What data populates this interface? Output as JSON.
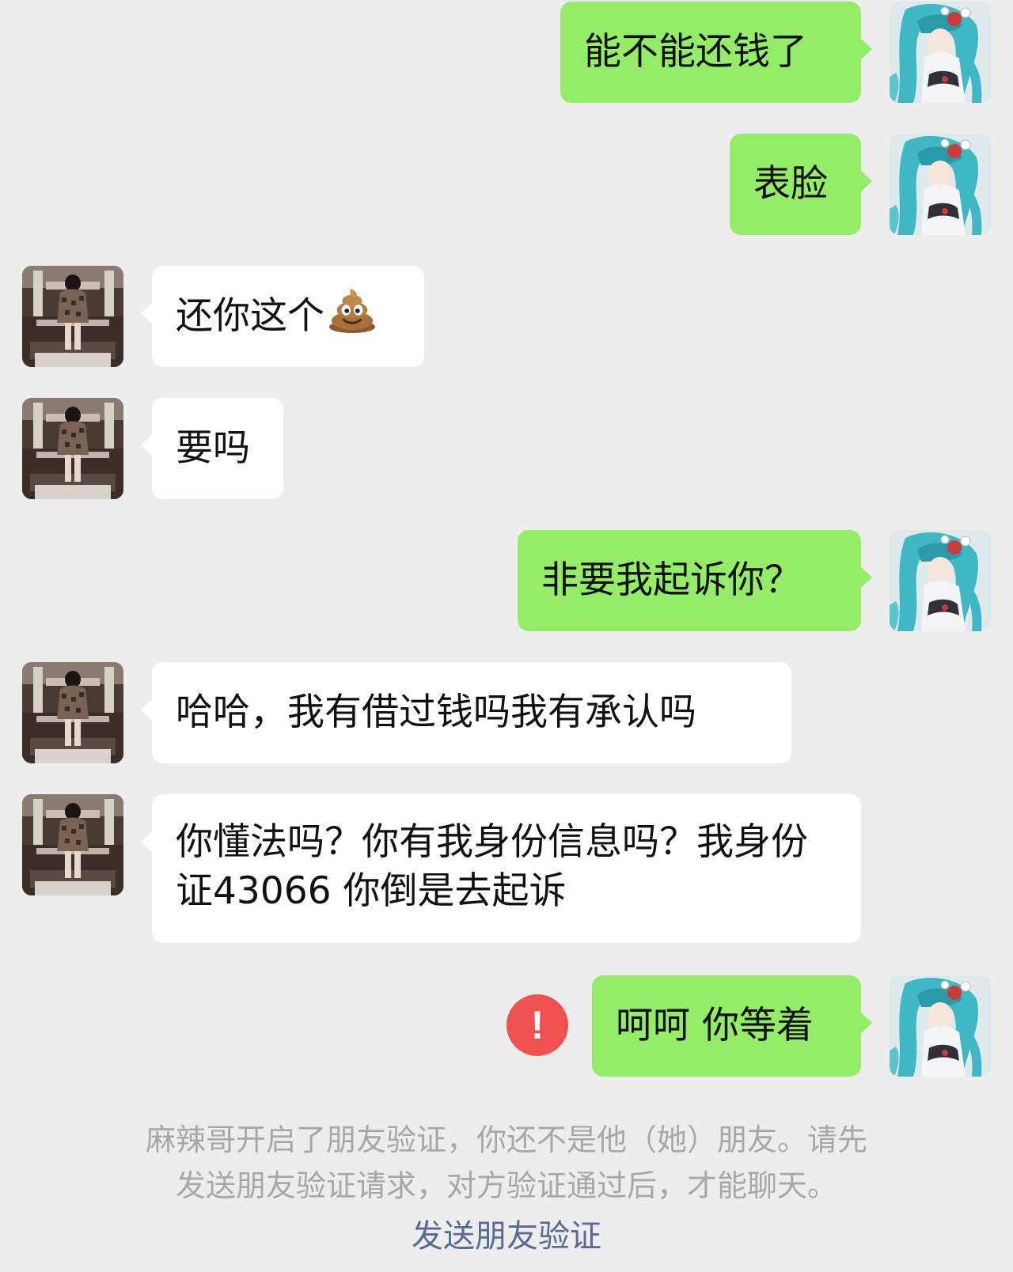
{
  "colors": {
    "background": "#ededed",
    "outgoing_bubble": "#95ec69",
    "incoming_bubble": "#ffffff",
    "error": "#f05252",
    "link": "#576b95",
    "notice_text": "#a7a7a7"
  },
  "messages": [
    {
      "direction": "outgoing",
      "text": "能不能还钱了"
    },
    {
      "direction": "outgoing",
      "text": "表脸"
    },
    {
      "direction": "incoming",
      "text": "还你这个",
      "emoji": "poop-icon"
    },
    {
      "direction": "incoming",
      "text": "要吗"
    },
    {
      "direction": "outgoing",
      "text": "非要我起诉你？"
    },
    {
      "direction": "incoming",
      "text": "哈哈，我有借过钱吗我有承认吗"
    },
    {
      "direction": "incoming",
      "text": "你懂法吗？你有我身份信息吗？我身份证43066   你倒是去起诉"
    },
    {
      "direction": "outgoing",
      "text": "呵呵 你等着",
      "status": "send-failed"
    }
  ],
  "error_mark": "!",
  "system_notice": {
    "line1": "麻辣哥开启了朋友验证，你还不是他（她）朋友。请先",
    "line2": "发送朋友验证请求，对方验证通过后，才能聊天。",
    "action": "发送朋友验证"
  }
}
